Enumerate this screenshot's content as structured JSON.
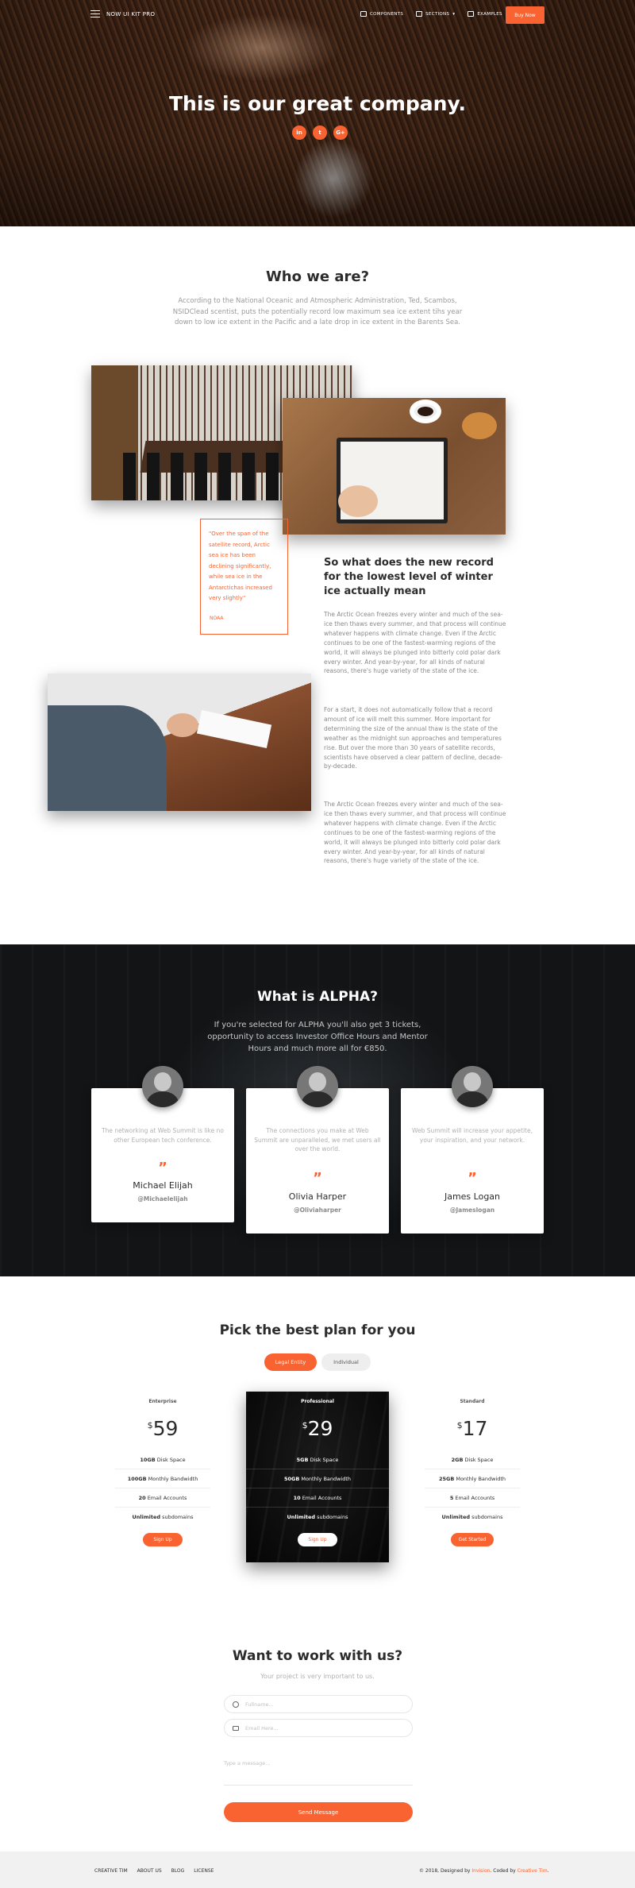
{
  "nav": {
    "brand": "NOW UI KIT PRO",
    "links": [
      "COMPONENTS",
      "SECTIONS",
      "EXAMPLES"
    ],
    "buy": "Buy Now"
  },
  "hero": {
    "title": "This is our great company.",
    "social": [
      "in",
      "t",
      "G+"
    ]
  },
  "who": {
    "title": "Who we are?",
    "lead": "According to the National Oceanic and Atmospheric Administration, Ted, Scambos, NSIDClead scentist, puts the potentially record low maximum sea ice extent tihs year down to low ice extent in the Pacific and a late drop in ice extent in the Barents Sea.",
    "quote": "\"Over the span of the satellite record, Arctic sea ice has been declining significantly, while sea ice in the Antarctichas increased very slightly\"",
    "quote_source": "NOAA",
    "heading": "So what does the new record for the lowest level of winter ice actually mean",
    "paragraphs": [
      "The Arctic Ocean freezes every winter and much of the sea-ice then thaws every summer, and that process will continue whatever happens with climate change. Even if the Arctic continues to be one of the fastest-warming regions of the world, it will always be plunged into bitterly cold polar dark every winter. And year-by-year, for all kinds of natural reasons, there's huge variety of the state of the ice.",
      "For a start, it does not automatically follow that a record amount of ice will melt this summer. More important for determining the size of the annual thaw is the state of the weather as the midnight sun approaches and temperatures rise. But over the more than 30 years of satellite records, scientists have observed a clear pattern of decline, decade-by-decade.",
      "The Arctic Ocean freezes every winter and much of the sea-ice then thaws every summer, and that process will continue whatever happens with climate change. Even if the Arctic continues to be one of the fastest-warming regions of the world, it will always be plunged into bitterly cold polar dark every winter. And year-by-year, for all kinds of natural reasons, there's huge variety of the state of the ice."
    ]
  },
  "alpha": {
    "title": "What is ALPHA?",
    "lead": "If you're selected for ALPHA you'll also get 3 tickets, opportunity to access Investor Office Hours and Mentor Hours and much more all for €850.",
    "cards": [
      {
        "text": "The networking at Web Summit is like no other European tech conference.",
        "name": "Michael Elijah",
        "handle": "@Michaelelijah"
      },
      {
        "text": "The connections you make at Web Summit are unparalleled, we met users all over the world.",
        "name": "Olivia Harper",
        "handle": "@Oliviaharper"
      },
      {
        "text": "Web Summit will increase your appetite, your inspiration, and your network.",
        "name": "James Logan",
        "handle": "@Jameslogan"
      }
    ],
    "quote_mark": "”"
  },
  "pricing": {
    "title": "Pick the best plan for you",
    "toggle": [
      "Legal Entity",
      "Individual"
    ],
    "plans": [
      {
        "tier": "Enterprise",
        "currency": "$",
        "price": "59",
        "features": [
          [
            "10GB",
            " Disk Space"
          ],
          [
            "100GB",
            " Monthly Bandwidth"
          ],
          [
            "20",
            " Email Accounts"
          ],
          [
            "Unlimited",
            " subdomains"
          ]
        ],
        "button": "Sign Up"
      },
      {
        "tier": "Professional",
        "currency": "$",
        "price": "29",
        "features": [
          [
            "5GB",
            " Disk Space"
          ],
          [
            "50GB",
            " Monthly Bandwidth"
          ],
          [
            "10",
            " Email Accounts"
          ],
          [
            "Unlimited",
            " subdomains"
          ]
        ],
        "button": "Sign Up"
      },
      {
        "tier": "Standard",
        "currency": "$",
        "price": "17",
        "features": [
          [
            "2GB",
            " Disk Space"
          ],
          [
            "25GB",
            " Monthly Bandwidth"
          ],
          [
            "5",
            " Email Accounts"
          ],
          [
            "Unlimited",
            " subdomains"
          ]
        ],
        "button": "Get Started"
      }
    ]
  },
  "contact": {
    "title": "Want to work with us?",
    "lead": "Your project is very important to us.",
    "fullname_placeholder": "Fullname...",
    "email_placeholder": "Email Here...",
    "message_placeholder": "Type a message...",
    "send": "Send Message"
  },
  "footer": {
    "links": [
      "CREATIVE TIM",
      "ABOUT US",
      "BLOG",
      "LICENSE"
    ],
    "copy_prefix": "© 2018, Designed by ",
    "designer": "Invision",
    "copy_mid": ". Coded by ",
    "coder": "Creative Tim",
    "copy_suffix": "."
  },
  "colors": {
    "accent": "#f96332",
    "dark": "#2c2c2c"
  }
}
